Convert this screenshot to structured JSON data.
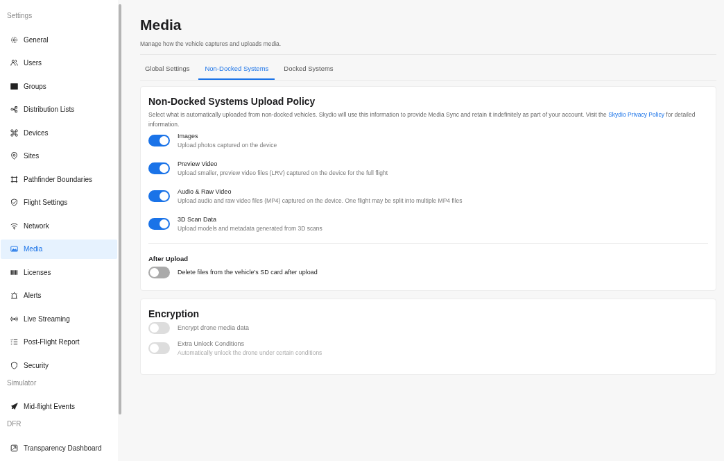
{
  "sidebar": {
    "sections": [
      {
        "heading": "Settings",
        "items": [
          {
            "label": "General",
            "selected": false
          },
          {
            "label": "Users",
            "selected": false
          },
          {
            "label": "Groups",
            "selected": false
          },
          {
            "label": "Distribution Lists",
            "selected": false
          },
          {
            "label": "Devices",
            "selected": false
          },
          {
            "label": "Sites",
            "selected": false
          },
          {
            "label": "Pathfinder Boundaries",
            "selected": false
          },
          {
            "label": "Flight Settings",
            "selected": false
          },
          {
            "label": "Network",
            "selected": false
          },
          {
            "label": "Media",
            "selected": true
          },
          {
            "label": "Licenses",
            "selected": false
          },
          {
            "label": "Alerts",
            "selected": false
          },
          {
            "label": "Live Streaming",
            "selected": false
          },
          {
            "label": "Post-Flight Report",
            "selected": false
          },
          {
            "label": "Security",
            "selected": false
          }
        ]
      },
      {
        "heading": "Simulator",
        "items": [
          {
            "label": "Mid-flight Events",
            "selected": false
          }
        ]
      },
      {
        "heading": "DFR",
        "items": [
          {
            "label": "Transparency Dashboard",
            "selected": false
          }
        ]
      }
    ]
  },
  "page": {
    "title": "Media",
    "subtitle": "Manage how the vehicle captures and uploads media."
  },
  "tabs": [
    {
      "label": "Global Settings",
      "selected": false
    },
    {
      "label": "Non-Docked Systems",
      "selected": true
    },
    {
      "label": "Docked Systems",
      "selected": false
    }
  ],
  "upload_policy": {
    "title": "Non-Docked Systems Upload Policy",
    "description_before": "Select what is automatically uploaded from non-docked vehicles. Skydio will use this information to provide Media Sync and retain it indefinitely as part of your account. Visit the",
    "description_link": "Skydio Privacy Policy",
    "description_after": "for detailed information.",
    "options": [
      {
        "label": "Images",
        "description": "Upload photos captured on the device",
        "on": true,
        "disabled": false
      },
      {
        "label": "Preview Video",
        "description": "Upload smaller, preview video files (LRV) captured on the device for the full flight",
        "on": true,
        "disabled": false
      },
      {
        "label": "Audio & Raw Video",
        "description": "Upload audio and raw video files (MP4) captured on the device. One flight may be split into multiple MP4 files",
        "on": true,
        "disabled": false
      },
      {
        "label": "3D Scan Data",
        "description": "Upload models and metadata generated from 3D scans",
        "on": true,
        "disabled": false
      }
    ],
    "after_upload": {
      "title": "After Upload",
      "options": [
        {
          "label": "Delete files from the vehicle's SD card after upload",
          "on": false,
          "disabled": false
        }
      ]
    }
  },
  "encryption": {
    "title": "Encryption",
    "options": [
      {
        "label": "Encrypt drone media data",
        "on": false,
        "disabled": true
      },
      {
        "label": "Extra Unlock Conditions",
        "description": "Automatically unlock the drone under certain conditions",
        "on": false,
        "disabled": true
      }
    ]
  }
}
